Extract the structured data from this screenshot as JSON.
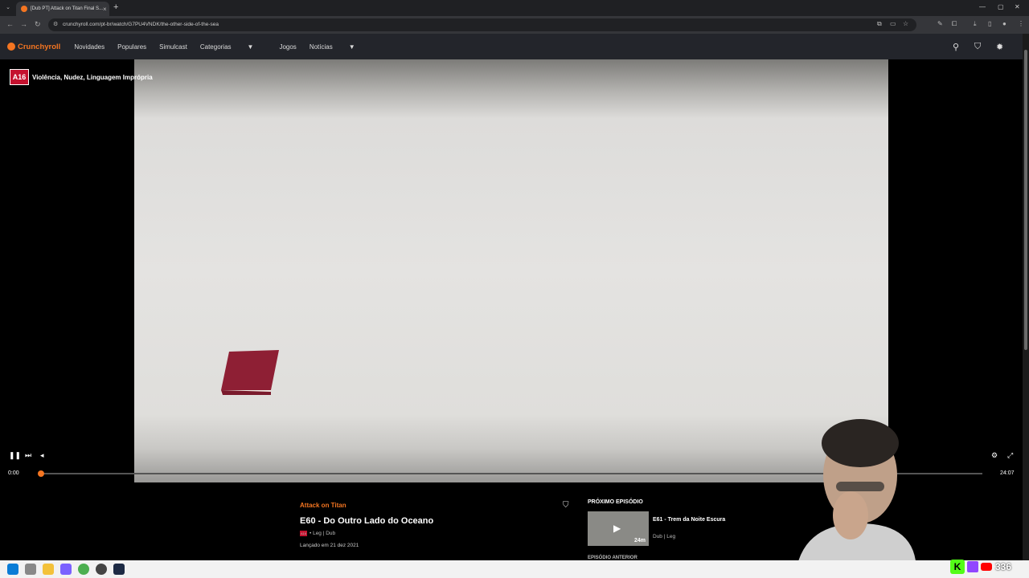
{
  "browser": {
    "tab_title": "[Dub PT] Attack on Titan Final S...",
    "tab_close": "×",
    "new_tab": "+",
    "url": "crunchyroll.com/pt-br/watch/G7PU4VNDK/the-other-side-of-the-sea"
  },
  "header": {
    "logo": "Crunchyroll",
    "nav": [
      "Novidades",
      "Populares",
      "Simulcast",
      "Categorias",
      "Jogos",
      "Notícias"
    ]
  },
  "player": {
    "rating_badge": "A16",
    "rating_desc": "Violência, Nudez, Linguagem Imprópria",
    "time_current": "0:00",
    "time_total": "24:07",
    "progress_fraction": 0.0
  },
  "episode": {
    "series": "Attack on Titan",
    "title": "E60 - Do Outro Lado do Oceano",
    "badge": "A16",
    "meta": "• Leg | Dub",
    "released": "Lançado em 21 dez 2021"
  },
  "next": {
    "label": "PRÓXIMO EPISÓDIO",
    "duration": "24m",
    "title": "E61 - Trem da Noite Escura",
    "meta": "Dub | Leg",
    "prev_label": "EPISÓDIO ANTERIOR"
  },
  "stream_widget": {
    "viewer_count": "336"
  },
  "colors": {
    "brand": "#f47521",
    "rating": "#c4122f"
  }
}
